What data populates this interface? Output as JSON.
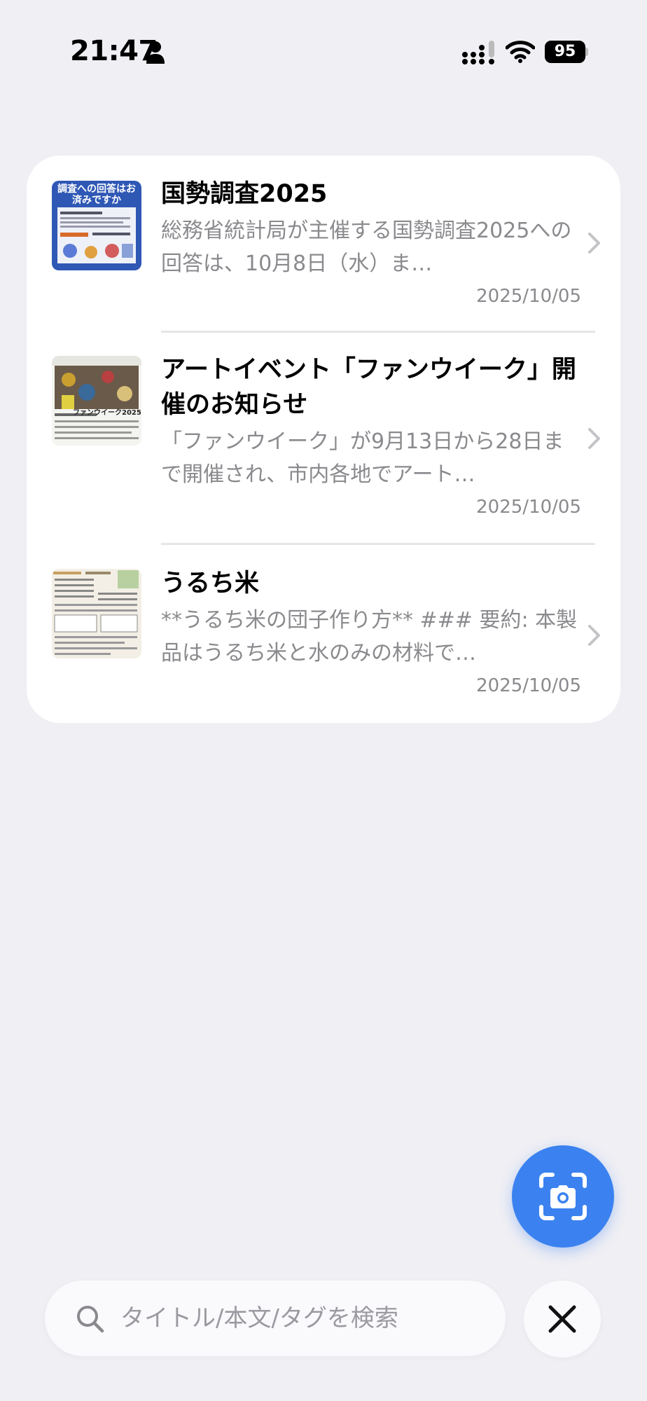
{
  "status_bar": {
    "time": "21:47",
    "battery": "95",
    "icons": [
      "person-icon",
      "signal-icon",
      "wifi-icon",
      "battery-icon"
    ]
  },
  "items": [
    {
      "title": "国勢調査2025",
      "summary": "総務省統計局が主催する国勢調査2025への回答は、10月8日（水）ま…",
      "date": "2025/10/05",
      "thumb_text": "調査への回答はお済みですか"
    },
    {
      "title": "アートイベント「ファンウイーク」開催のお知らせ",
      "summary": "「ファンウイーク」が9月13日から28日まで開催され、市内各地でアート…",
      "date": "2025/10/05",
      "thumb_text": "ファンウイーク2025"
    },
    {
      "title": "うるち米",
      "summary": "**うるち米の団子作り方** ### 要約: 本製品はうるち米と水のみの材料で…",
      "date": "2025/10/05"
    }
  ],
  "search": {
    "placeholder": "タイトル/本文/タグを検索",
    "value": ""
  },
  "colors": {
    "accent": "#3b82f0",
    "background": "#efeff4",
    "secondary_text": "#8a8a8e"
  }
}
